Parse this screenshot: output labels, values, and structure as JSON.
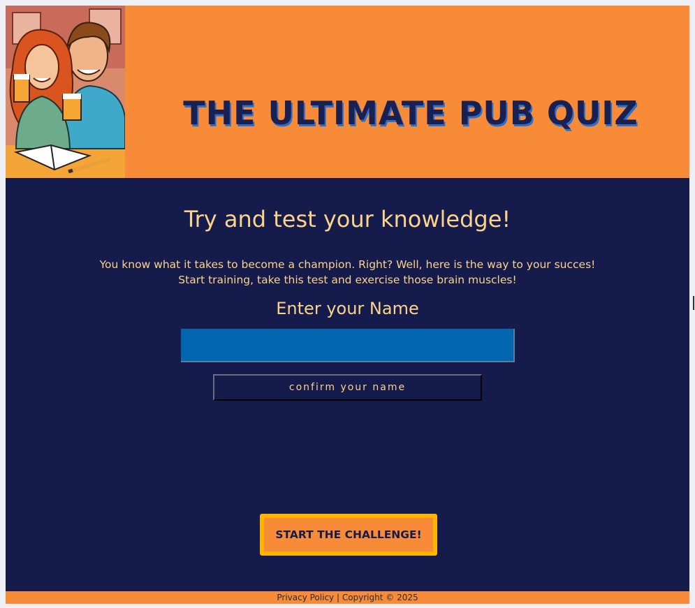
{
  "header": {
    "title": "THE ULTIMATE PUB QUIZ",
    "logo_icon": "pub-couple-illustration-icon"
  },
  "main": {
    "heading": "Try and test your knowledge!",
    "intro_line1": "You know what it takes to become a champion. Right? Well, here is the way to your succes!",
    "intro_line2": "Start training, take this test and exercise those brain muscles!",
    "name_label": "Enter your Name",
    "name_input_value": "",
    "confirm_label": "confirm your name",
    "start_label": "START THE CHALLENGE!"
  },
  "footer": {
    "privacy_label": "Privacy Policy",
    "separator": " | ",
    "copyright": "Copyright © 2025"
  },
  "colors": {
    "header_bg": "#f78b38",
    "main_bg": "#151b4b",
    "text": "#fbd38a",
    "input_bg": "#0265b0",
    "button_border": "#ffb400"
  }
}
